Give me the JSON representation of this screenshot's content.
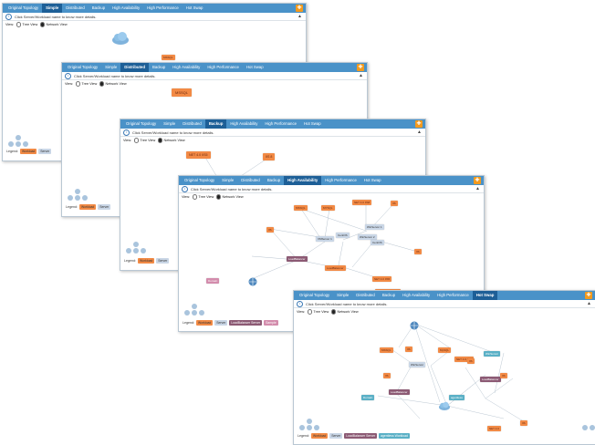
{
  "tabs": [
    "Original Topology",
    "Simple",
    "Distributed",
    "Backup",
    "High Availability",
    "High Performance",
    "Hot Swap"
  ],
  "info_text": "Click Server/Workload name to know more details.",
  "view_label": "View:",
  "view_tree": "Tree View",
  "view_network": "Network View",
  "legend_label": "Legend:",
  "legend": {
    "workload": "Workload",
    "server": "Server",
    "load_balancer": "LoadBalancer Server",
    "sample": "Sample",
    "agentless": "agentless Workload"
  },
  "colors": {
    "tabbar": "#4a92c8",
    "active_tab": "#1d5f97",
    "workload": "#f28a45",
    "server": "#c9d6e6",
    "load_balancer": "#8c5a74"
  },
  "panels": {
    "p1": {
      "active_tab": "Simple",
      "nodes": [
        "MSSQL"
      ]
    },
    "p2": {
      "active_tab": "Distributed",
      "nodes": [
        "MSSQL"
      ]
    },
    "p3": {
      "active_tab": "Backup",
      "nodes": [
        "NET 4.0 IIS5",
        "IIS 8"
      ]
    },
    "p4": {
      "active_tab": "High Availability",
      "nodes": [
        "NET 4.0 IIS8",
        "MSSQL",
        "MYSQL",
        "IIS",
        "IIS",
        "IIS",
        "LoadBalancer",
        "Domain",
        "NET 4.0 IIS5",
        "WinServer 1",
        "WinServer 2",
        "VMServer 1",
        "CentOS",
        "CentOS",
        "LoadBalancer",
        "Windows2008 R2"
      ]
    },
    "p5": {
      "active_tab": "Hot Swap",
      "nodes": [
        "MSSQL",
        "IIS",
        "MySQL",
        "NET 4.0 IIS8",
        "IIS",
        "IIS",
        "WinServer",
        "Domain",
        "LoadBalancer",
        "LoadBalancer",
        "WinServer",
        "IIS",
        "IIS",
        "NET 4.0",
        "agentless"
      ]
    }
  }
}
